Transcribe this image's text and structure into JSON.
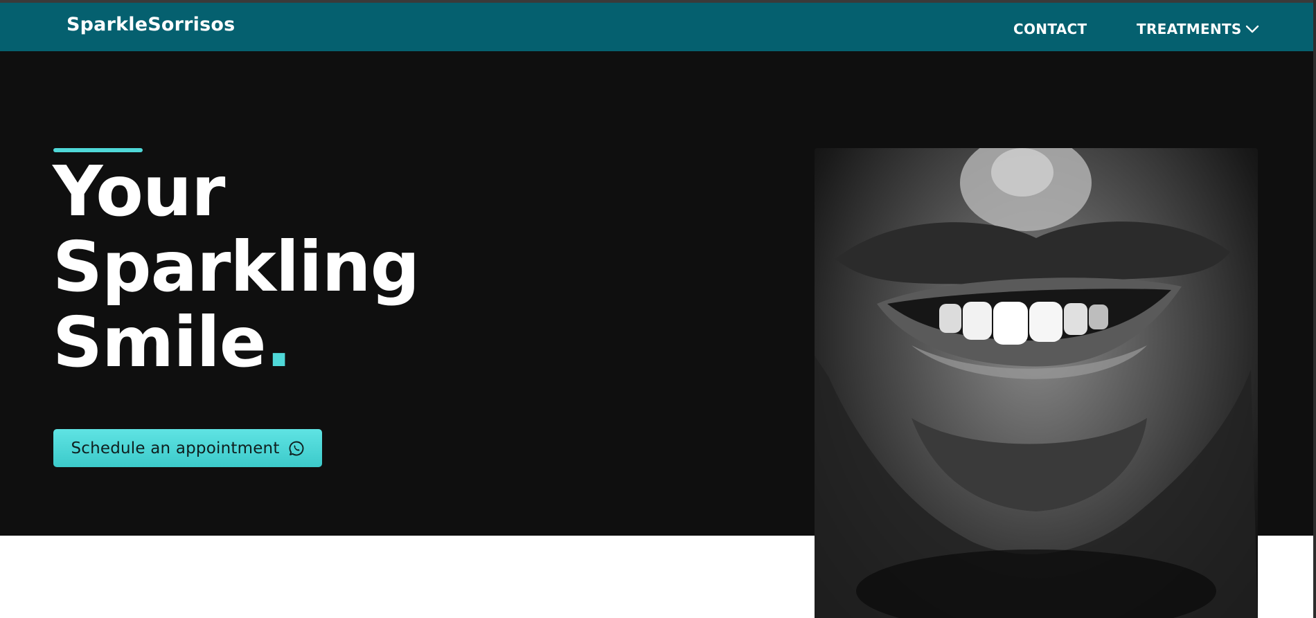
{
  "header": {
    "brand": "SparkleSorrisos",
    "nav": {
      "contact": "CONTACT",
      "treatments": "TREATMENTS"
    }
  },
  "hero": {
    "title_line1": "Your",
    "title_line2": "Sparkling",
    "title_line3": "Smile",
    "title_dot": ".",
    "cta_label": "Schedule an appointment"
  },
  "icons": {
    "treatments_dropdown": "chevron-down-icon",
    "cta": "whatsapp-icon"
  },
  "colors": {
    "header_bg": "#05606f",
    "hero_bg": "#0f0f0f",
    "accent": "#4fd8d8"
  }
}
